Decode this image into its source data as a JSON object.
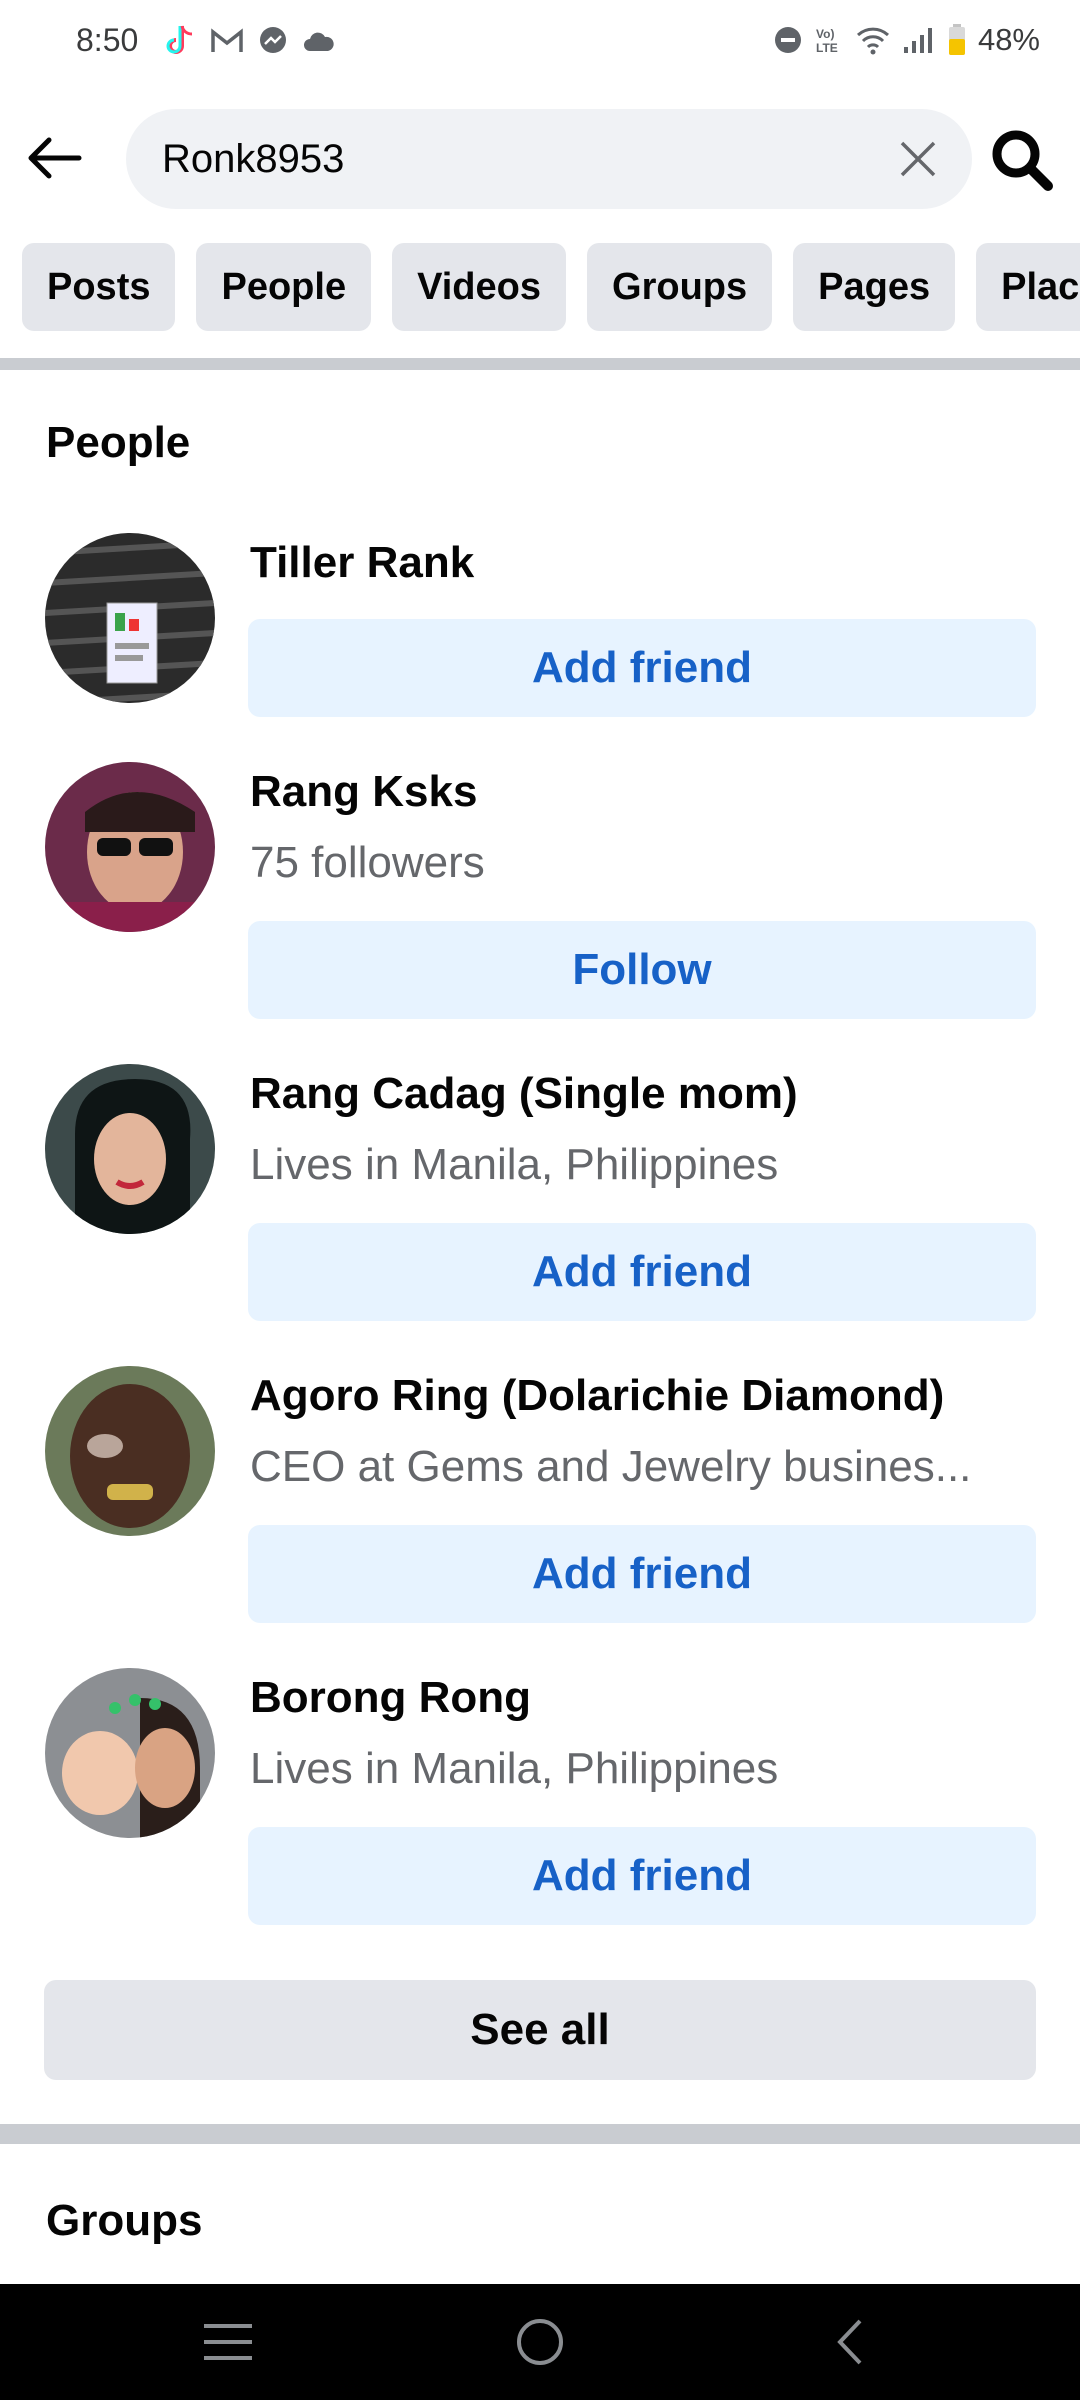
{
  "status_bar": {
    "time": "8:50",
    "battery": "48%",
    "icons": [
      "tiktok-icon",
      "gmail-icon",
      "messenger-icon",
      "cloud-icon",
      "dnd-icon",
      "volte-icon",
      "wifi-icon",
      "signal-icon",
      "battery-icon"
    ]
  },
  "search": {
    "query": "Ronk8953",
    "back_icon": "back-arrow-icon",
    "clear_icon": "close-icon",
    "search_icon": "search-icon"
  },
  "filters": [
    "Posts",
    "People",
    "Videos",
    "Groups",
    "Pages",
    "Places"
  ],
  "people_section": {
    "title": "People",
    "results": [
      {
        "name": "Tiller Rank",
        "subtitle": "",
        "action": "Add friend"
      },
      {
        "name": "Rang Ksks",
        "subtitle": "75 followers",
        "action": "Follow"
      },
      {
        "name": "Rang Cadag (Single mom)",
        "subtitle": "Lives in Manila, Philippines",
        "action": "Add friend"
      },
      {
        "name": "Agoro Ring (Dolarichie Diamond)",
        "subtitle": "CEO at Gems and Jewelry busines...",
        "action": "Add friend"
      },
      {
        "name": "Borong Rong",
        "subtitle": "Lives in Manila, Philippines",
        "action": "Add friend"
      }
    ],
    "see_all": "See all"
  },
  "groups_section": {
    "title": "Groups"
  },
  "nav": {
    "items": [
      "menu-icon",
      "home-icon",
      "back-icon"
    ]
  },
  "colors": {
    "accent": "#1761c7",
    "button_bg": "#e7f3ff",
    "chip_bg": "#e4e6eb",
    "search_bg": "#f0f2f5"
  }
}
